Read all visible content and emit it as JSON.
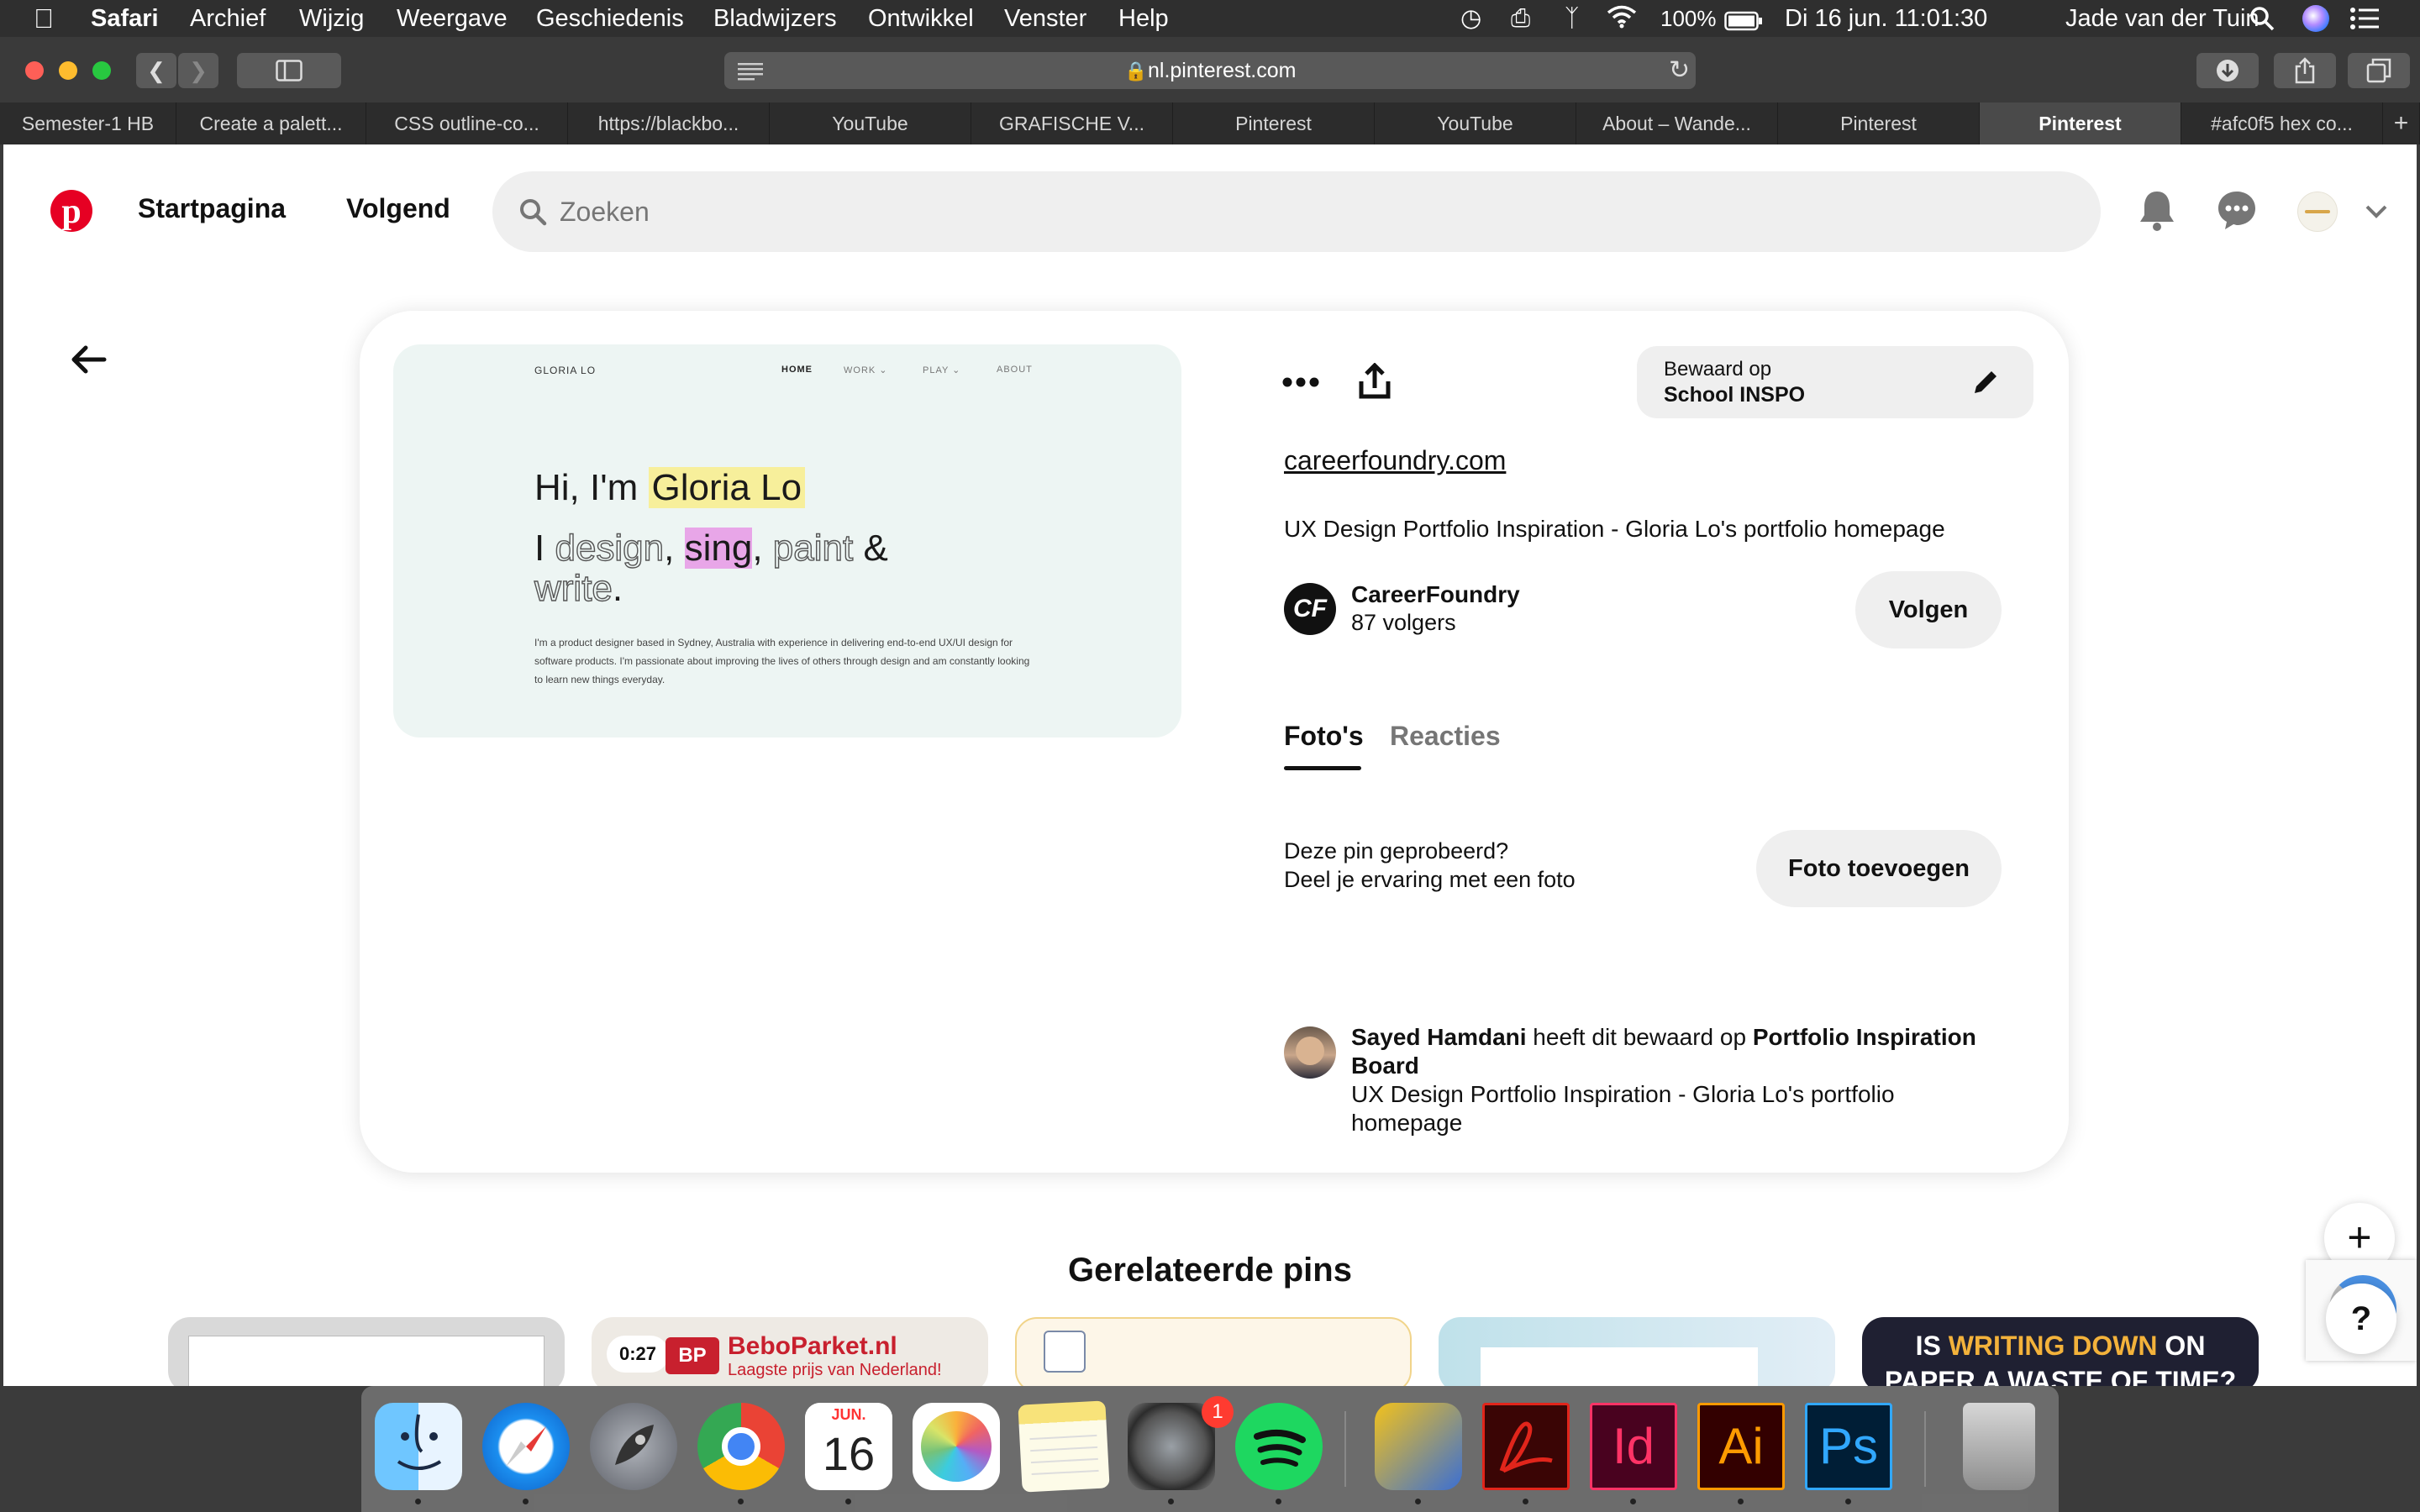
{
  "menubar": {
    "app_name": "Safari",
    "items": [
      "Archief",
      "Wijzig",
      "Weergave",
      "Geschiedenis",
      "Bladwijzers",
      "Ontwikkel",
      "Venster",
      "Help"
    ],
    "battery": "100%",
    "datetime": "Di 16 jun.  11:01:30",
    "user": "Jade van der Tuin"
  },
  "browser": {
    "url": "nl.pinterest.com",
    "tabs": [
      "Semester-1 HB",
      "Create a palett...",
      "CSS outline-co...",
      "https://blackbo...",
      "YouTube",
      "GRAFISCHE V...",
      "Pinterest",
      "YouTube",
      "About – Wande...",
      "Pinterest",
      "Pinterest",
      "#afc0f5 hex co..."
    ],
    "active_tab_index": 10
  },
  "header": {
    "nav_home": "Startpagina",
    "nav_following": "Volgend",
    "search_placeholder": "Zoeken"
  },
  "pin": {
    "image": {
      "logo": "GLORIA LO",
      "nav": [
        "HOME",
        "WORK ⌄",
        "PLAY ⌄",
        "ABOUT"
      ],
      "headline_prefix": "Hi, I'm ",
      "headline_name": "Gloria Lo",
      "line2_i": "I",
      "line2_design": "design",
      "line2_comma1": ",",
      "line2_sing": "sing",
      "line2_comma2": ",",
      "line2_paint": "paint",
      "line2_amp": "&",
      "line3_write": "write",
      "line3_dot": ".",
      "body": "I'm a product designer based in Sydney, Australia with experience in delivering end-to-end UX/UI design for software products. I'm passionate about improving the lives of others through design and am constantly looking to learn new things everyday."
    },
    "saved_to_label": "Bewaard op",
    "saved_to_board": "School INSPO",
    "source_link": "careerfoundry.com",
    "description": "UX Design Portfolio Inspiration - Gloria Lo's portfolio homepage",
    "creator": {
      "name": "CareerFoundry",
      "followers": "87 volgers",
      "avatar_text": "CF",
      "follow_label": "Volgen"
    },
    "tabs": [
      "Foto's",
      "Reacties"
    ],
    "tried_line1": "Deze pin geprobeerd?",
    "tried_line2": "Deel je ervaring met een foto",
    "add_photo_label": "Foto toevoegen",
    "activity": {
      "user": "Sayed Hamdani",
      "action": " heeft dit bewaard op ",
      "board": "Portfolio Inspiration Board",
      "text": "UX Design Portfolio Inspiration - Gloria Lo's portfolio homepage"
    }
  },
  "related": {
    "title": "Gerelateerde pins",
    "pin2_duration": "0:27",
    "pin2_brand": "BeboParket.nl",
    "pin2_tagline": "Laagste prijs van Nederland!",
    "pin5_text1": "IS ",
    "pin5_text2": "WRITING DOWN",
    "pin5_text3": " ON",
    "pin5_text4": "PAPER A WASTE OF TIME?"
  },
  "floating": {
    "plus": "+",
    "help": "?"
  },
  "dock": {
    "calendar_month": "JUN.",
    "calendar_day": "16",
    "settings_badge": "1",
    "indesign": "Id",
    "illustrator": "Ai",
    "photoshop": "Ps"
  },
  "colors": {
    "pinterest_red": "#e60023",
    "highlight_yellow": "#f7ef9b",
    "highlight_pink": "#e8a6e8",
    "pin_bg": "#edf5f3"
  }
}
